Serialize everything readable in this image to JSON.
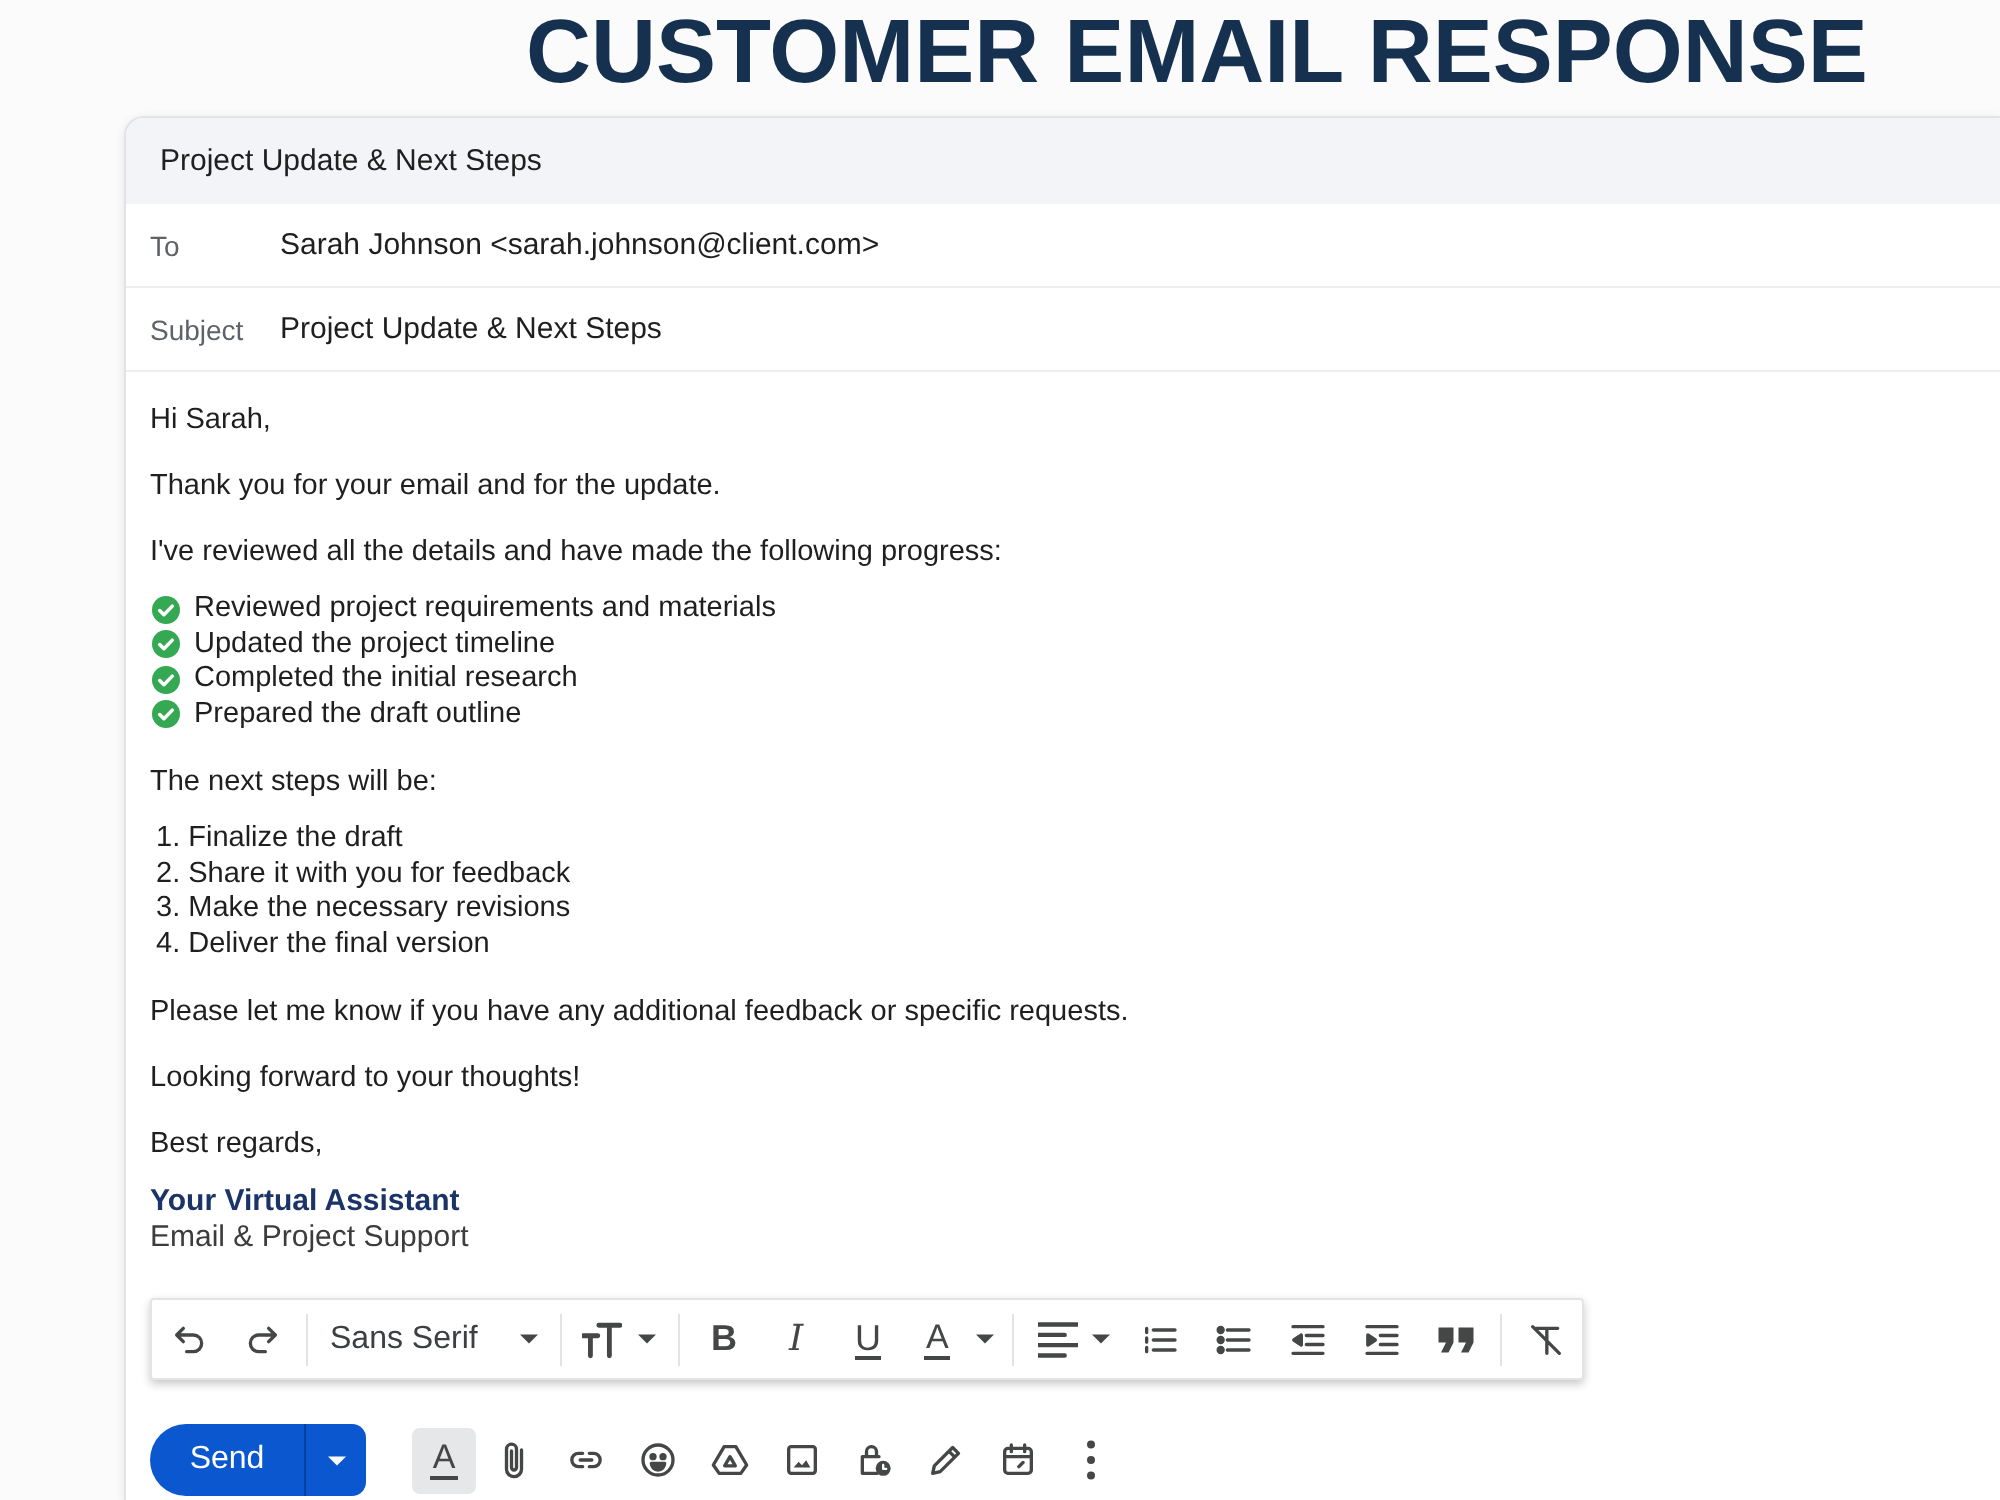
{
  "page_title": "CUSTOMER EMAIL RESPONSE",
  "compose": {
    "header_title": "Project Update & Next Steps",
    "fields": [
      {
        "label": "To",
        "value": "Sarah Johnson <sarah.johnson@client.com>"
      },
      {
        "label": "Subject",
        "value": "Project Update & Next Steps"
      }
    ],
    "body": [
      {
        "kind": "paragraph",
        "text": "Hi Sarah,"
      },
      {
        "kind": "paragraph",
        "text": "Thank you for your email and for the update."
      },
      {
        "kind": "paragraph",
        "text": "I've reviewed all the details and have made the following progress:"
      },
      {
        "kind": "checklist",
        "items": [
          {
            "text": "Reviewed project requirements and materials",
            "checked": true
          },
          {
            "text": "Updated the project timeline",
            "checked": true
          },
          {
            "text": "Completed the initial research",
            "checked": true
          },
          {
            "text": "Prepared the draft outline",
            "checked": true
          }
        ]
      },
      {
        "kind": "paragraph",
        "text": "The next steps will be:"
      },
      {
        "kind": "numbered",
        "items": [
          "1. Finalize the draft",
          "2. Share it with you for feedback",
          "3. Make the necessary revisions",
          "4. Deliver the final version"
        ]
      },
      {
        "kind": "paragraph",
        "text": "Please let me know if you have any additional feedback or specific requests."
      },
      {
        "kind": "paragraph",
        "text": "Looking forward to your thoughts!"
      },
      {
        "kind": "paragraph",
        "text": "Best regards,"
      },
      {
        "kind": "signature",
        "name": "Your Virtual Assistant",
        "role": "Email & Project Support"
      }
    ]
  },
  "format_toolbar": {
    "font": "Sans Serif",
    "bold": "B",
    "italic": "I",
    "underline": "U",
    "text_color": "A"
  },
  "send_bar": {
    "send": "Send",
    "format_label": "A",
    "format_selected": true
  }
}
